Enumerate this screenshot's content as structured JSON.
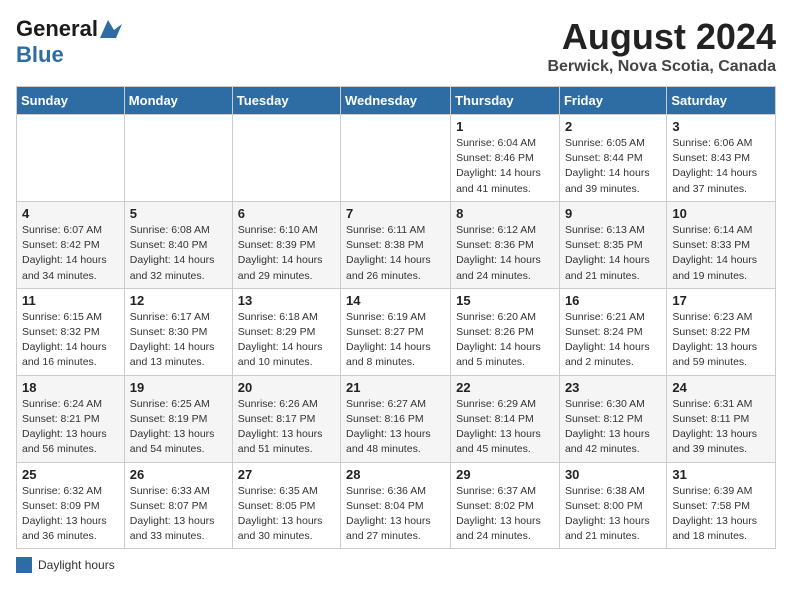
{
  "header": {
    "logo_general": "General",
    "logo_blue": "Blue",
    "month": "August 2024",
    "location": "Berwick, Nova Scotia, Canada"
  },
  "days_of_week": [
    "Sunday",
    "Monday",
    "Tuesday",
    "Wednesday",
    "Thursday",
    "Friday",
    "Saturday"
  ],
  "weeks": [
    [
      {
        "day": "",
        "info": ""
      },
      {
        "day": "",
        "info": ""
      },
      {
        "day": "",
        "info": ""
      },
      {
        "day": "",
        "info": ""
      },
      {
        "day": "1",
        "info": "Sunrise: 6:04 AM\nSunset: 8:46 PM\nDaylight: 14 hours\nand 41 minutes."
      },
      {
        "day": "2",
        "info": "Sunrise: 6:05 AM\nSunset: 8:44 PM\nDaylight: 14 hours\nand 39 minutes."
      },
      {
        "day": "3",
        "info": "Sunrise: 6:06 AM\nSunset: 8:43 PM\nDaylight: 14 hours\nand 37 minutes."
      }
    ],
    [
      {
        "day": "4",
        "info": "Sunrise: 6:07 AM\nSunset: 8:42 PM\nDaylight: 14 hours\nand 34 minutes."
      },
      {
        "day": "5",
        "info": "Sunrise: 6:08 AM\nSunset: 8:40 PM\nDaylight: 14 hours\nand 32 minutes."
      },
      {
        "day": "6",
        "info": "Sunrise: 6:10 AM\nSunset: 8:39 PM\nDaylight: 14 hours\nand 29 minutes."
      },
      {
        "day": "7",
        "info": "Sunrise: 6:11 AM\nSunset: 8:38 PM\nDaylight: 14 hours\nand 26 minutes."
      },
      {
        "day": "8",
        "info": "Sunrise: 6:12 AM\nSunset: 8:36 PM\nDaylight: 14 hours\nand 24 minutes."
      },
      {
        "day": "9",
        "info": "Sunrise: 6:13 AM\nSunset: 8:35 PM\nDaylight: 14 hours\nand 21 minutes."
      },
      {
        "day": "10",
        "info": "Sunrise: 6:14 AM\nSunset: 8:33 PM\nDaylight: 14 hours\nand 19 minutes."
      }
    ],
    [
      {
        "day": "11",
        "info": "Sunrise: 6:15 AM\nSunset: 8:32 PM\nDaylight: 14 hours\nand 16 minutes."
      },
      {
        "day": "12",
        "info": "Sunrise: 6:17 AM\nSunset: 8:30 PM\nDaylight: 14 hours\nand 13 minutes."
      },
      {
        "day": "13",
        "info": "Sunrise: 6:18 AM\nSunset: 8:29 PM\nDaylight: 14 hours\nand 10 minutes."
      },
      {
        "day": "14",
        "info": "Sunrise: 6:19 AM\nSunset: 8:27 PM\nDaylight: 14 hours\nand 8 minutes."
      },
      {
        "day": "15",
        "info": "Sunrise: 6:20 AM\nSunset: 8:26 PM\nDaylight: 14 hours\nand 5 minutes."
      },
      {
        "day": "16",
        "info": "Sunrise: 6:21 AM\nSunset: 8:24 PM\nDaylight: 14 hours\nand 2 minutes."
      },
      {
        "day": "17",
        "info": "Sunrise: 6:23 AM\nSunset: 8:22 PM\nDaylight: 13 hours\nand 59 minutes."
      }
    ],
    [
      {
        "day": "18",
        "info": "Sunrise: 6:24 AM\nSunset: 8:21 PM\nDaylight: 13 hours\nand 56 minutes."
      },
      {
        "day": "19",
        "info": "Sunrise: 6:25 AM\nSunset: 8:19 PM\nDaylight: 13 hours\nand 54 minutes."
      },
      {
        "day": "20",
        "info": "Sunrise: 6:26 AM\nSunset: 8:17 PM\nDaylight: 13 hours\nand 51 minutes."
      },
      {
        "day": "21",
        "info": "Sunrise: 6:27 AM\nSunset: 8:16 PM\nDaylight: 13 hours\nand 48 minutes."
      },
      {
        "day": "22",
        "info": "Sunrise: 6:29 AM\nSunset: 8:14 PM\nDaylight: 13 hours\nand 45 minutes."
      },
      {
        "day": "23",
        "info": "Sunrise: 6:30 AM\nSunset: 8:12 PM\nDaylight: 13 hours\nand 42 minutes."
      },
      {
        "day": "24",
        "info": "Sunrise: 6:31 AM\nSunset: 8:11 PM\nDaylight: 13 hours\nand 39 minutes."
      }
    ],
    [
      {
        "day": "25",
        "info": "Sunrise: 6:32 AM\nSunset: 8:09 PM\nDaylight: 13 hours\nand 36 minutes."
      },
      {
        "day": "26",
        "info": "Sunrise: 6:33 AM\nSunset: 8:07 PM\nDaylight: 13 hours\nand 33 minutes."
      },
      {
        "day": "27",
        "info": "Sunrise: 6:35 AM\nSunset: 8:05 PM\nDaylight: 13 hours\nand 30 minutes."
      },
      {
        "day": "28",
        "info": "Sunrise: 6:36 AM\nSunset: 8:04 PM\nDaylight: 13 hours\nand 27 minutes."
      },
      {
        "day": "29",
        "info": "Sunrise: 6:37 AM\nSunset: 8:02 PM\nDaylight: 13 hours\nand 24 minutes."
      },
      {
        "day": "30",
        "info": "Sunrise: 6:38 AM\nSunset: 8:00 PM\nDaylight: 13 hours\nand 21 minutes."
      },
      {
        "day": "31",
        "info": "Sunrise: 6:39 AM\nSunset: 7:58 PM\nDaylight: 13 hours\nand 18 minutes."
      }
    ]
  ],
  "legend": {
    "label": "Daylight hours"
  }
}
